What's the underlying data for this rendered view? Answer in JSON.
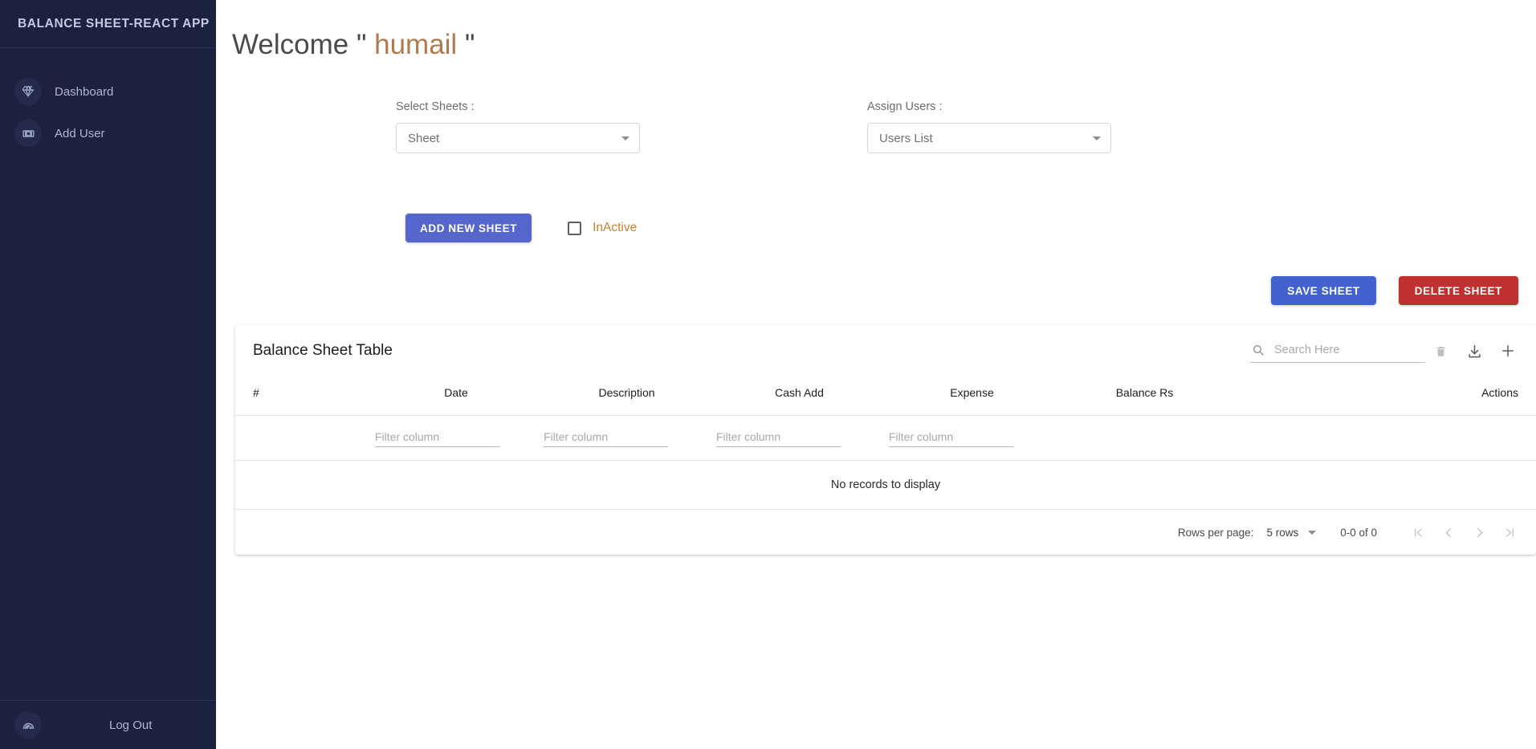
{
  "sidebar": {
    "brand": "BALANCE SHEET-REACT APP",
    "items": [
      {
        "label": "Dashboard",
        "icon": "diamond-icon"
      },
      {
        "label": "Add User",
        "icon": "money-bill-icon"
      }
    ],
    "logout": {
      "label": "Log Out",
      "icon": "gauge-icon"
    },
    "bg_color": "#1b2240"
  },
  "main": {
    "welcome_prefix": "Welcome \" ",
    "welcome_user": "humail",
    "welcome_suffix": " \"",
    "selects": [
      {
        "label": "Select Sheets :",
        "value": "Sheet"
      },
      {
        "label": "Assign Users :",
        "value": "Users List"
      }
    ],
    "add_new_sheet_label": "ADD NEW SHEET",
    "inactive_label": "InActive",
    "inactive_checked": false,
    "save_sheet_label": "SAVE SHEET",
    "delete_sheet_label": "DELETE SHEET",
    "accent_blue": "#5566cc",
    "save_blue": "#4362cd",
    "delete_red": "#bf3030",
    "inactive_text_color": "#c6822f"
  },
  "table": {
    "title": "Balance Sheet Table",
    "search_placeholder": "Search Here",
    "search_value": "",
    "toolbar_icons": [
      "search-icon",
      "clear-search-icon",
      "download-icon",
      "add-row-icon"
    ],
    "columns": [
      "#",
      "Date",
      "Description",
      "Cash Add",
      "Expense",
      "Balance Rs",
      "Actions"
    ],
    "filter_placeholder": "Filter column",
    "filter_values": [
      "",
      "",
      "",
      ""
    ],
    "empty_message": "No records to display",
    "rows": []
  },
  "pagination": {
    "rows_per_page_label": "Rows per page:",
    "rows_per_page_value": "5 rows",
    "range_label": "0-0 of 0",
    "first_page_icon": "|<",
    "prev_page_icon": "‹",
    "next_page_icon": "›",
    "last_page_icon": ">|"
  }
}
